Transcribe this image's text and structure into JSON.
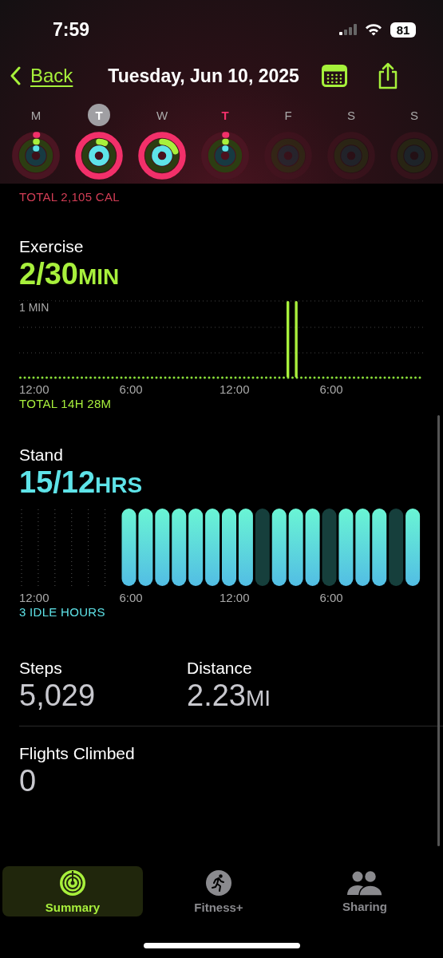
{
  "status_bar": {
    "time": "7:59",
    "battery": "81"
  },
  "nav": {
    "back": "Back",
    "title": "Tuesday, Jun 10, 2025"
  },
  "days": [
    {
      "letter": "M",
      "selected": false,
      "today": false,
      "future": false,
      "rings": [
        {
          "kind": "move",
          "level": 0.01
        },
        {
          "kind": "exercise",
          "level": 0.01
        },
        {
          "kind": "stand",
          "level": 0.01
        }
      ]
    },
    {
      "letter": "T",
      "selected": true,
      "today": false,
      "future": false,
      "rings": [
        {
          "kind": "move",
          "level": 1
        },
        {
          "kind": "exercise",
          "level": 0.07
        },
        {
          "kind": "stand",
          "level": 1
        }
      ]
    },
    {
      "letter": "W",
      "selected": false,
      "today": false,
      "future": false,
      "rings": [
        {
          "kind": "move",
          "level": 1
        },
        {
          "kind": "exercise",
          "level": 0.2
        },
        {
          "kind": "stand",
          "level": 0.92
        }
      ]
    },
    {
      "letter": "T",
      "selected": false,
      "today": true,
      "future": false,
      "rings": [
        {
          "kind": "move",
          "level": 0.01
        },
        {
          "kind": "exercise",
          "level": 0.01
        },
        {
          "kind": "stand",
          "level": 0.01
        }
      ]
    },
    {
      "letter": "F",
      "selected": false,
      "today": false,
      "future": true
    },
    {
      "letter": "S",
      "selected": false,
      "today": false,
      "future": true
    },
    {
      "letter": "S",
      "selected": false,
      "today": false,
      "future": true
    }
  ],
  "move": {
    "total": "TOTAL 2,105 CAL"
  },
  "exercise": {
    "label": "Exercise",
    "value": "2/30",
    "unit": "MIN",
    "total": "TOTAL 14H 28M",
    "y_label": "1 MIN",
    "x_labels": [
      "12:00",
      "6:00",
      "12:00",
      "6:00"
    ]
  },
  "stand": {
    "label": "Stand",
    "value": "15/12",
    "unit": "HRS",
    "idle": "3 IDLE HOURS",
    "x_labels": [
      "12:00",
      "6:00",
      "12:00",
      "6:00"
    ],
    "hours": [
      {
        "kind": "empty"
      },
      {
        "kind": "empty"
      },
      {
        "kind": "empty"
      },
      {
        "kind": "empty"
      },
      {
        "kind": "empty"
      },
      {
        "kind": "empty"
      },
      {
        "kind": "stood"
      },
      {
        "kind": "stood"
      },
      {
        "kind": "stood"
      },
      {
        "kind": "stood"
      },
      {
        "kind": "stood"
      },
      {
        "kind": "stood"
      },
      {
        "kind": "stood"
      },
      {
        "kind": "stood"
      },
      {
        "kind": "idle"
      },
      {
        "kind": "stood"
      },
      {
        "kind": "stood"
      },
      {
        "kind": "stood"
      },
      {
        "kind": "idle"
      },
      {
        "kind": "stood"
      },
      {
        "kind": "stood"
      },
      {
        "kind": "stood"
      },
      {
        "kind": "idle"
      },
      {
        "kind": "stood"
      }
    ]
  },
  "stats": [
    {
      "label": "Steps",
      "value": "5,029"
    },
    {
      "label": "Distance",
      "value": "2.23",
      "unit": "MI"
    }
  ],
  "flights": {
    "label": "Flights Climbed",
    "value": "0"
  },
  "tabs": [
    {
      "label": "Summary",
      "selected": true
    },
    {
      "label": "Fitness+",
      "selected": false
    },
    {
      "label": "Sharing",
      "selected": false
    }
  ]
}
